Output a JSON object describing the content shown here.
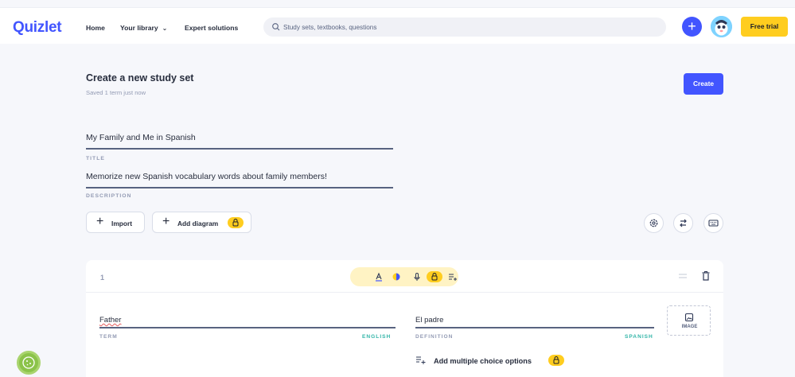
{
  "nav": {
    "logo": "Quizlet",
    "home": "Home",
    "library": "Your library",
    "expert": "Expert solutions",
    "search_placeholder": "Study sets, textbooks, questions",
    "free_trial": "Free trial"
  },
  "header": {
    "title": "Create a new study set",
    "saved_status": "Saved 1 term just now",
    "create_label": "Create"
  },
  "set": {
    "title_value": "My Family and Me in Spanish",
    "title_label": "TITLE",
    "description_value": "Memorize new Spanish vocabulary words about family members!",
    "description_label": "DESCRIPTION"
  },
  "actions": {
    "import_label": "Import",
    "diagram_label": "Add diagram"
  },
  "card": {
    "number": "1",
    "term_value": "Father",
    "term_label": "TERM",
    "term_language": "ENGLISH",
    "definition_value": "El padre",
    "definition_label": "DEFINITION",
    "definition_language": "SPANISH",
    "image_label": "IMAGE",
    "multiple_choice_label": "Add multiple choice options"
  },
  "colors": {
    "brand": "#4255ff",
    "accent_yellow": "#ffcd1f",
    "language_teal": "#32b5a8",
    "background": "#f6f7fb"
  },
  "icons": [
    "search-icon",
    "plus-icon",
    "avatar",
    "settings-icon",
    "swap-icon",
    "keyboard-icon",
    "text-format-icon",
    "color-icon",
    "microphone-icon",
    "lock-icon",
    "list-add-icon",
    "drag-handle-icon",
    "trash-icon",
    "image-icon",
    "cookie-icon"
  ]
}
